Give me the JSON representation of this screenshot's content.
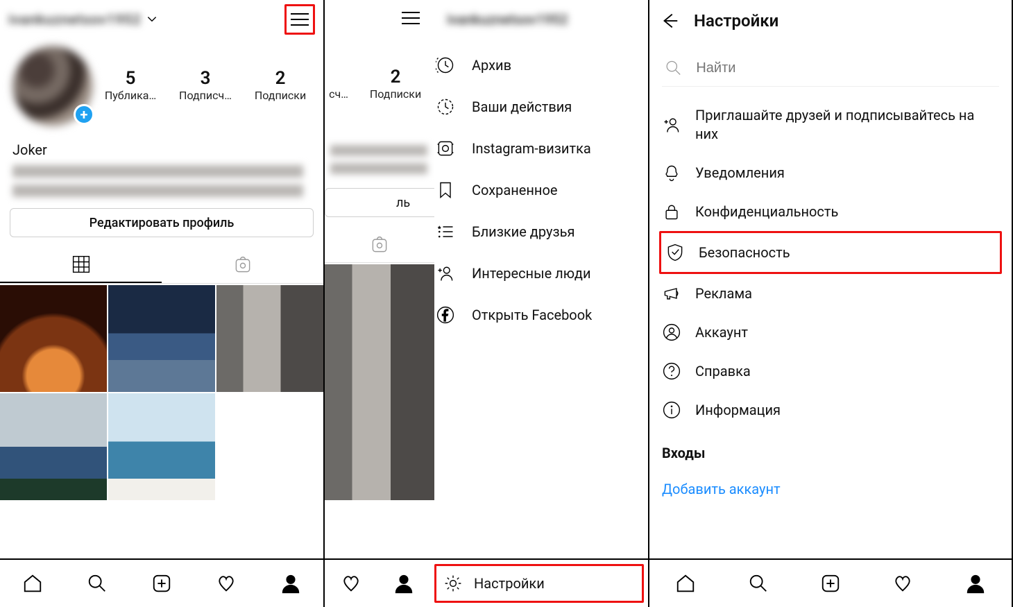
{
  "panel1": {
    "username_blur": "ivankuznetsov1952",
    "stats": [
      {
        "num": "5",
        "label": "Публика…"
      },
      {
        "num": "3",
        "label": "Подписч…"
      },
      {
        "num": "2",
        "label": "Подписки"
      }
    ],
    "display_name": "Joker",
    "edit_profile": "Редактировать профиль"
  },
  "panel2": {
    "header_username_blur": "ivankuznetsov1952",
    "stats_frag": [
      {
        "num": "2",
        "label": "Подписки"
      }
    ],
    "stats_frag_left_label": "сч…",
    "edit_profile_frag": "ль",
    "menu": [
      {
        "icon": "archive-icon",
        "label": "Архив"
      },
      {
        "icon": "activity-icon",
        "label": "Ваши действия"
      },
      {
        "icon": "nametag-icon",
        "label": "Instagram-визитка"
      },
      {
        "icon": "bookmark-icon",
        "label": "Сохраненное"
      },
      {
        "icon": "close-friends-icon",
        "label": "Близкие друзья"
      },
      {
        "icon": "discover-people-icon",
        "label": "Интересные люди"
      },
      {
        "icon": "facebook-icon",
        "label": "Открыть Facebook"
      }
    ],
    "settings_label": "Настройки"
  },
  "panel3": {
    "title": "Настройки",
    "search_placeholder": "Найти",
    "items": [
      {
        "icon": "add-friend-icon",
        "label": "Приглашайте друзей и подписывайтесь на них",
        "twoLine": true
      },
      {
        "icon": "bell-icon",
        "label": "Уведомления"
      },
      {
        "icon": "lock-icon",
        "label": "Конфиденциальность"
      },
      {
        "icon": "shield-check-icon",
        "label": "Безопасность",
        "highlight": true
      },
      {
        "icon": "megaphone-icon",
        "label": "Реклама"
      },
      {
        "icon": "account-icon",
        "label": "Аккаунт"
      },
      {
        "icon": "help-icon",
        "label": "Справка"
      },
      {
        "icon": "info-icon",
        "label": "Информация"
      }
    ],
    "logins_heading": "Входы",
    "add_account": "Добавить аккаунт"
  }
}
